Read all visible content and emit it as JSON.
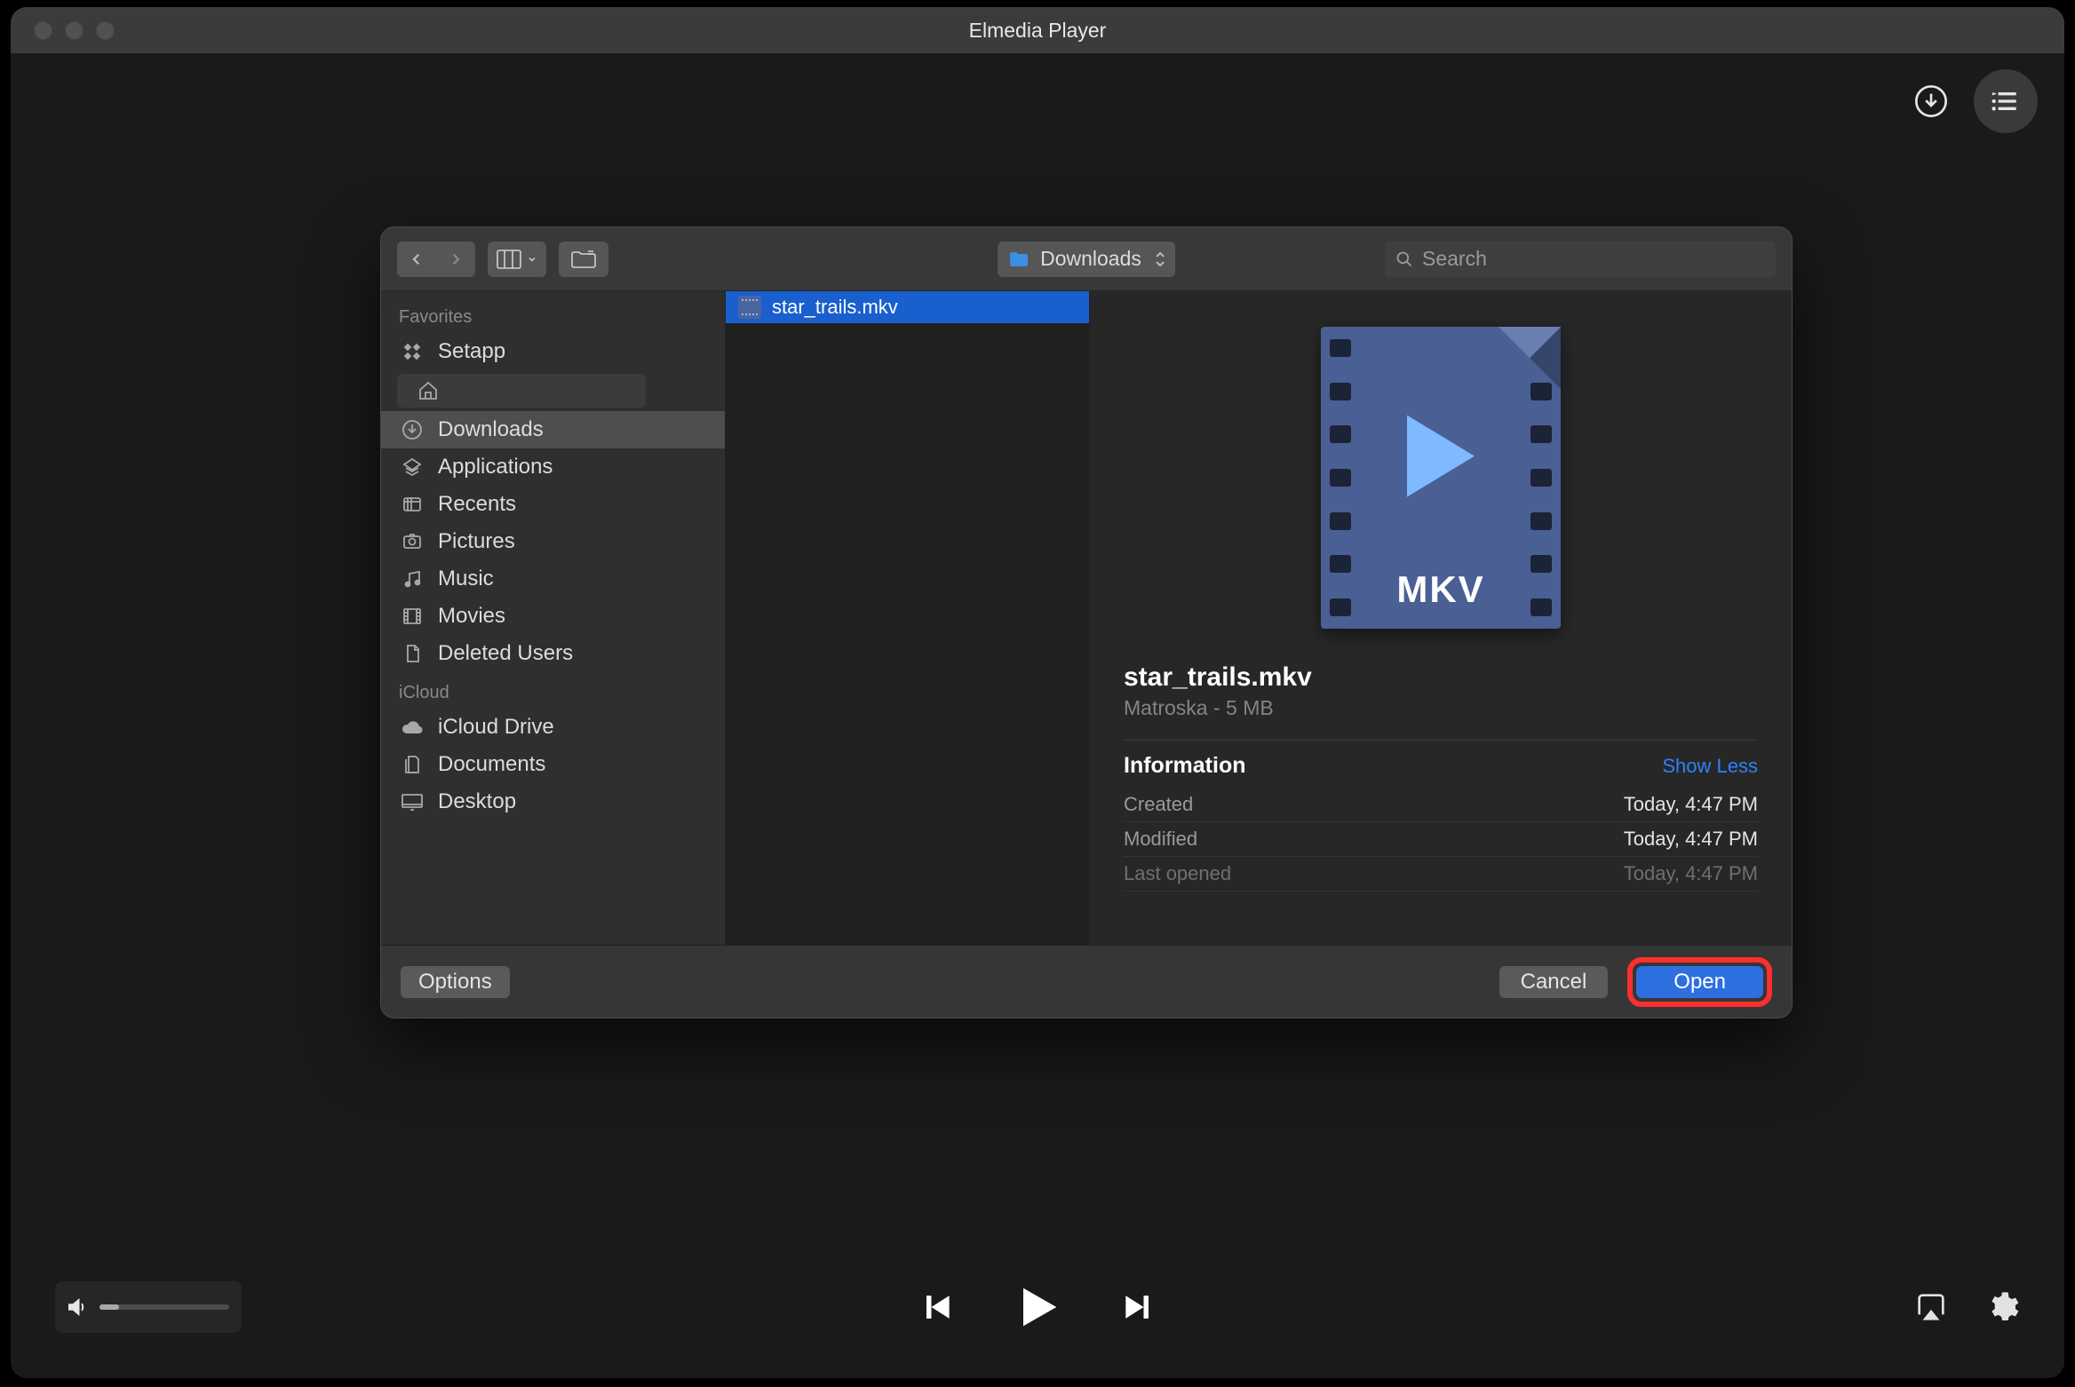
{
  "appWindow": {
    "title": "Elmedia Player"
  },
  "fileDialog": {
    "toolbar": {
      "location": "Downloads",
      "searchPlaceholder": "Search"
    },
    "sidebar": {
      "sections": [
        {
          "label": "Favorites",
          "items": [
            {
              "icon": "setapp",
              "label": "Setapp"
            },
            {
              "icon": "home",
              "label": ""
            },
            {
              "icon": "downloads",
              "label": "Downloads",
              "selected": true
            },
            {
              "icon": "applications",
              "label": "Applications"
            },
            {
              "icon": "recents",
              "label": "Recents"
            },
            {
              "icon": "pictures",
              "label": "Pictures"
            },
            {
              "icon": "music",
              "label": "Music"
            },
            {
              "icon": "movies",
              "label": "Movies"
            },
            {
              "icon": "document",
              "label": "Deleted Users"
            }
          ]
        },
        {
          "label": "iCloud",
          "items": [
            {
              "icon": "cloud",
              "label": "iCloud Drive"
            },
            {
              "icon": "documents",
              "label": "Documents"
            },
            {
              "icon": "desktop",
              "label": "Desktop"
            }
          ]
        }
      ]
    },
    "fileList": [
      {
        "name": "star_trails.mkv",
        "selected": true
      }
    ],
    "preview": {
      "filename": "star_trails.mkv",
      "subtitle": "Matroska - 5 MB",
      "iconLabel": "MKV",
      "infoTitle": "Information",
      "showLess": "Show Less",
      "rows": [
        {
          "k": "Created",
          "v": "Today, 4:47 PM"
        },
        {
          "k": "Modified",
          "v": "Today, 4:47 PM"
        },
        {
          "k": "Last opened",
          "v": "Today, 4:47 PM"
        }
      ]
    },
    "footer": {
      "options": "Options",
      "cancel": "Cancel",
      "open": "Open"
    }
  }
}
